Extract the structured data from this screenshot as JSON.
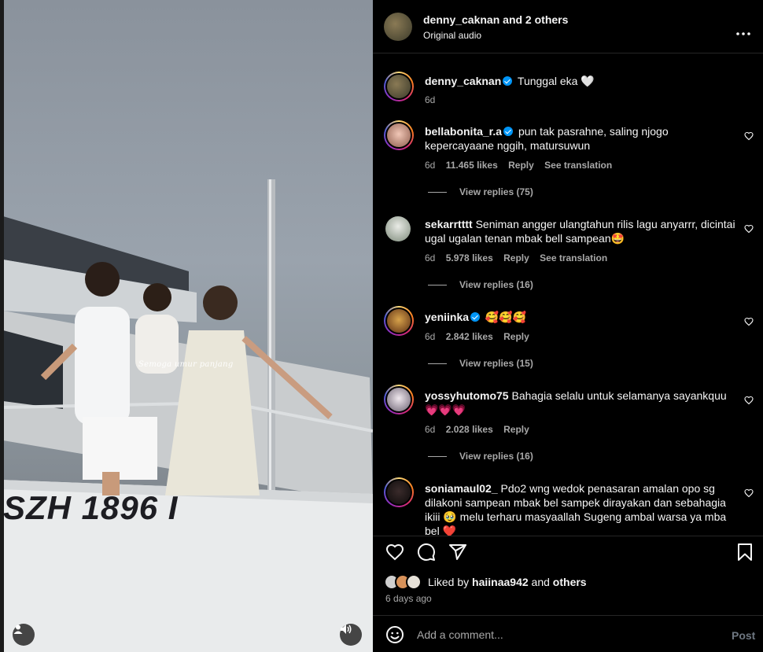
{
  "media": {
    "overlay_caption": "Semoga umur panjang",
    "hull_registration": "SZH 1896 I",
    "icons": {
      "profile": "person-icon",
      "sound": "speaker-icon"
    }
  },
  "header": {
    "username": "denny_caknan",
    "coauthors": "and 2 others",
    "audio": "Original audio",
    "more_icon": "more-horizontal-icon"
  },
  "caption": {
    "username": "denny_caknan",
    "text": "Tunggal eka 🤍",
    "age": "6d"
  },
  "comments": [
    {
      "username": "bellabonita_r.a",
      "verified": true,
      "text": "pun tak pasrahne, saling njogo kepercayaane nggih, matursuwun",
      "age": "6d",
      "likes": "11.465 likes",
      "reply": "Reply",
      "translate": "See translation",
      "replies": "View replies (75)"
    },
    {
      "username": "sekarrtttt",
      "verified": false,
      "text": "Seniman angger ulangtahun rilis lagu anyarrr, dicintai ugal ugalan tenan mbak bell sampean🤩",
      "age": "6d",
      "likes": "5.978 likes",
      "reply": "Reply",
      "translate": "See translation",
      "replies": "View replies (16)"
    },
    {
      "username": "yeniinka",
      "verified": true,
      "text": "🥰🥰🥰",
      "age": "6d",
      "likes": "2.842 likes",
      "reply": "Reply",
      "translate": "",
      "replies": "View replies (15)"
    },
    {
      "username": "yossyhutomo75",
      "verified": false,
      "text": "Bahagia selalu untuk selamanya sayankquu 💗💗💗",
      "age": "6d",
      "likes": "2.028 likes",
      "reply": "Reply",
      "translate": "",
      "replies": "View replies (16)"
    },
    {
      "username": "soniamaul02_",
      "verified": false,
      "text": "Pdo2 wng wedok penasaran amalan opo sg dilakoni sampean mbak bel sampek dirayakan dan sebahagia ikiii 🥹 melu terharu masyaallah Sugeng ambal warsa ya mba bel ❤️",
      "age": "",
      "likes": "",
      "reply": "",
      "translate": "",
      "replies": ""
    }
  ],
  "actions": {
    "icons": [
      "heart-icon",
      "comment-icon",
      "share-icon",
      "bookmark-icon"
    ],
    "liked_prefix": "Liked by",
    "liked_user": "haiinaa942",
    "liked_and": "and",
    "liked_others": "others",
    "time_ago": "6 days ago"
  },
  "add_comment": {
    "placeholder": "Add a comment...",
    "post_label": "Post",
    "emoji_icon": "emoji-icon"
  },
  "colors": {
    "background": "#000000",
    "text": "#f5f5f5",
    "secondary_text": "#a8a8a8",
    "verified_blue": "#0095f6",
    "divider": "#262626"
  }
}
